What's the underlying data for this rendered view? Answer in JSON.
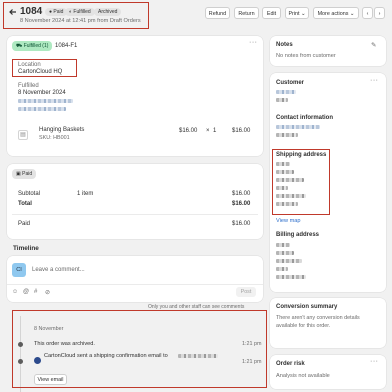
{
  "header": {
    "back_icon": "arrow-left-icon",
    "order_number": "1084",
    "paid_badge": "Paid",
    "fulfilled_badge": "Fulfilled",
    "archived_badge": "Archived",
    "subtitle": "8 November 2024 at 12:41 pm from Draft Orders",
    "actions": [
      "Refund",
      "Return",
      "Edit",
      "Print ⌄",
      "More actions ⌄"
    ]
  },
  "fulfillment": {
    "badge": "Fulfilled (1)",
    "code": "1084-F1",
    "location_label": "Location",
    "location_value": "CartonCloud HQ",
    "fulfilled_label": "Fulfilled",
    "fulfilled_date": "8 November 2024",
    "item_name": "Hanging Baskets",
    "item_sku": "SKU: HB001",
    "item_price": "$16.00",
    "item_times": "×",
    "item_qty": "1",
    "item_total": "$16.00"
  },
  "payment": {
    "badge": "Paid",
    "subtotal_label": "Subtotal",
    "subtotal_items": "1 item",
    "subtotal_value": "$16.00",
    "total_label": "Total",
    "total_value": "$16.00",
    "paid_label": "Paid",
    "paid_value": "$16.00"
  },
  "timeline": {
    "title": "Timeline",
    "avatar_initials": "CI",
    "comment_placeholder": "Leave a comment...",
    "post_label": "Post",
    "toolbar_icons": [
      "emoji-icon",
      "mention-icon",
      "hashtag-icon",
      "attachment-icon"
    ],
    "note": "Only you and other staff can see comments",
    "date_header": "8 November",
    "events": [
      {
        "text": "This order was archived.",
        "time": "1:21 pm"
      },
      {
        "text": "CartonCloud sent a shipping confirmation email to",
        "time": "1:21 pm",
        "button": "View email"
      }
    ]
  },
  "notes": {
    "title": "Notes",
    "edit_icon": "pencil-icon",
    "text": "No notes from customer"
  },
  "customer": {
    "title": "Customer",
    "contact_title": "Contact information",
    "shipping_title": "Shipping address",
    "view_map": "View map",
    "billing_title": "Billing address"
  },
  "conversion": {
    "title": "Conversion summary",
    "text": "There aren't any conversion details available for this order."
  },
  "risk": {
    "title": "Order risk",
    "text": "Analysis not available"
  },
  "colors": {
    "accent_link": "#2c6ecb",
    "fulfilled_green": "#aee9c1",
    "annotation_red": "#c0392b"
  }
}
